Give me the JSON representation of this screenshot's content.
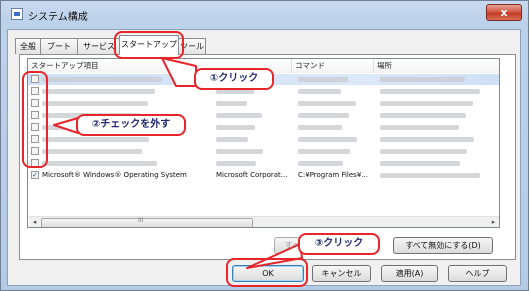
{
  "window": {
    "title": "システム構成",
    "close_label": "x"
  },
  "tabs": [
    {
      "label": "全般"
    },
    {
      "label": "ブート"
    },
    {
      "label": "サービス"
    },
    {
      "label": "スタートアップ"
    },
    {
      "label": "ツール"
    }
  ],
  "active_tab": "スタートアップ",
  "list": {
    "columns": [
      "スタートアップ項目",
      "",
      "コマンド",
      "場所"
    ],
    "rows": [
      {
        "checked": false,
        "selected": true,
        "item": "",
        "maker": "",
        "command": "",
        "location": ""
      },
      {
        "checked": false,
        "selected": false,
        "item": "",
        "maker": "",
        "command": "",
        "location": ""
      },
      {
        "checked": false,
        "selected": false,
        "item": "",
        "maker": "",
        "command": "",
        "location": ""
      },
      {
        "checked": false,
        "selected": false,
        "item": "",
        "maker": "",
        "command": "",
        "location": ""
      },
      {
        "checked": false,
        "selected": false,
        "item": "",
        "maker": "",
        "command": "",
        "location": ""
      },
      {
        "checked": false,
        "selected": false,
        "item": "",
        "maker": "",
        "command": "",
        "location": ""
      },
      {
        "checked": false,
        "selected": false,
        "item": "",
        "maker": "",
        "command": "",
        "location": ""
      },
      {
        "checked": false,
        "selected": false,
        "item": "",
        "maker": "",
        "command": "",
        "location": ""
      },
      {
        "checked": true,
        "selected": false,
        "item": "Microsoft® Windows® Operating System",
        "maker": "Microsoft Corporat...",
        "command": "C:¥Program Files¥...",
        "location": ""
      }
    ]
  },
  "scrollbar": {
    "left_arrow": "◂",
    "right_arrow": "▸",
    "grip": "III"
  },
  "buttons": {
    "enable_all": "すべて有効にする(E)",
    "disable_all": "すべて無効にする(D)",
    "ok": "OK",
    "cancel": "キャンセル",
    "apply": "適用(A)",
    "help": "ヘルプ"
  },
  "annotations": {
    "step1": "①クリック",
    "step2": "②チェックを外す",
    "step3": "③クリック"
  },
  "colors": {
    "annotation_border": "#e6262a",
    "annotation_text": "#1e2a6e",
    "selection": "#cfe0f6"
  }
}
